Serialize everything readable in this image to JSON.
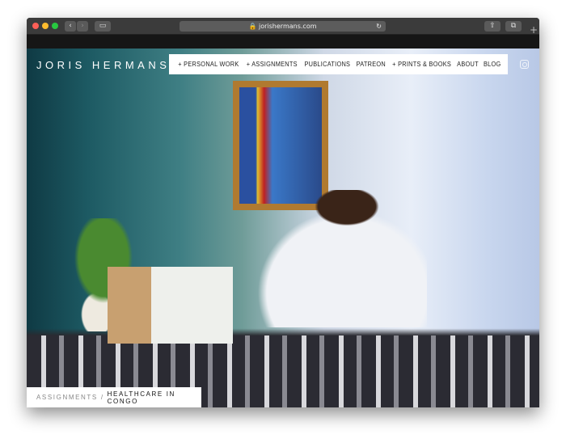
{
  "browser": {
    "url": "jorishermans.com",
    "back_icon": "chevron-left-icon",
    "forward_icon": "chevron-right-icon",
    "new_tab_label": "+"
  },
  "site": {
    "brand": "JORIS HERMANS",
    "nav": [
      {
        "label": "+ PERSONAL WORK"
      },
      {
        "label": "+ ASSIGNMENTS"
      },
      {
        "label": "PUBLICATIONS"
      },
      {
        "label": "PATREON"
      },
      {
        "label": "+ PRINTS & BOOKS"
      },
      {
        "label": "ABOUT"
      },
      {
        "label": "BLOG"
      }
    ],
    "social_icon": "instagram-icon",
    "breadcrumb": {
      "parent": "ASSIGNMENTS",
      "separator": "/",
      "current": "HEALTHCARE IN CONGO"
    }
  },
  "colors": {
    "close": "#fe5f57",
    "minimize": "#febc2e",
    "zoom": "#28c840"
  }
}
